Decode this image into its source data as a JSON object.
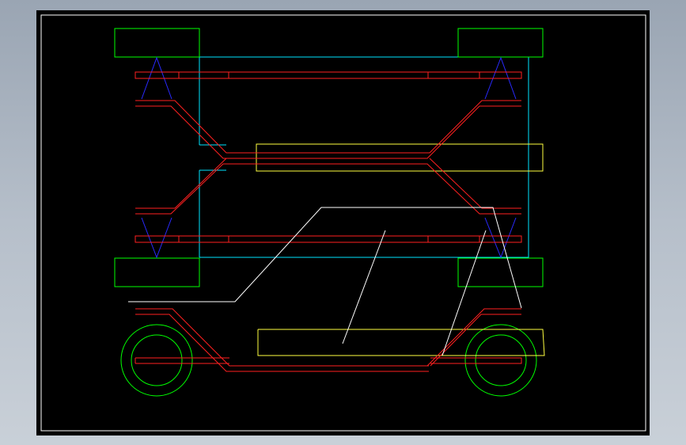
{
  "colors": {
    "background": "#000000",
    "frame": "#ffffff",
    "red": "#ff2020",
    "green": "#00ff00",
    "cyan": "#00e5ff",
    "yellow": "#ffff40",
    "blue": "#2a2aff",
    "white": "#ffffff"
  },
  "drawing": {
    "description_visible_text": ""
  }
}
